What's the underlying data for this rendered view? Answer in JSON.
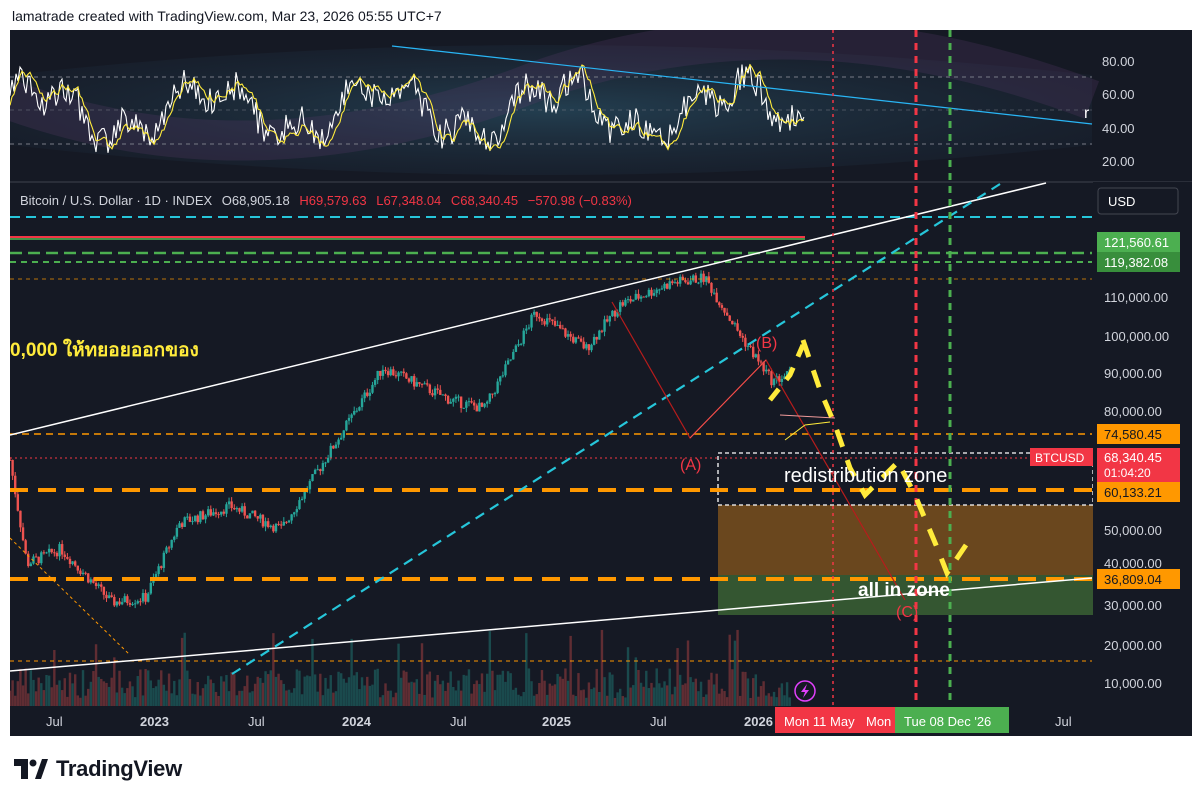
{
  "header": {
    "attribution": "lamatrade created with TradingView.com, Mar 23, 2026 05:55 UTC+7"
  },
  "footer": {
    "brand": "TradingView"
  },
  "symbol_line": {
    "name": "Bitcoin / U.S. Dollar · 1D · INDEX",
    "open": "O68,905.18",
    "high": "H69,579.63",
    "low": "L67,348.04",
    "close": "C68,340.45",
    "change": "−570.98 (−0.83%)"
  },
  "currency_button": "USD",
  "oscillator": {
    "axis_ticks": [
      "80.00",
      "60.00",
      "40.00",
      "20.00"
    ],
    "cut_label": "r"
  },
  "price_axis": {
    "ticks": [
      "110,000.00",
      "100,000.00",
      "90,000.00",
      "80,000.00",
      "50,000.00",
      "40,000.00",
      "30,000.00",
      "20,000.00",
      "10,000.00"
    ]
  },
  "price_badges": {
    "b1": "121,560.61",
    "b2": "119,382.08",
    "b3": "74,580.45",
    "b4_symbol": "BTCUSD",
    "b4_price": "68,340.45",
    "b4_timer": "01:04:20",
    "b5": "60,133.21",
    "b6": "36,809.04"
  },
  "time_axis": {
    "ticks": [
      "Jul",
      "2023",
      "Jul",
      "2024",
      "Jul",
      "2025",
      "Jul",
      "2026",
      "Jul"
    ],
    "badge_red": "Mon 11 May",
    "badge_red2": "Mon",
    "badge_green": "Tue 08 Dec '26"
  },
  "annotations": {
    "thai_text": "0,000 ให้ทยอยออกของ",
    "wave_a": "(A)",
    "wave_b": "(B)",
    "wave_c": "(C)",
    "redistribution": "redistribution zone",
    "all_in": "all in zone"
  },
  "colors": {
    "background": "#151924",
    "orange": "#ff9800",
    "green": "#4caf50",
    "red": "#f23645",
    "cyan": "#26c6da",
    "yellow": "#ffeb3b",
    "candle_up": "#26a69a",
    "candle_down": "#ef5350"
  },
  "chart_data": {
    "type": "candlestick",
    "symbol": "BTCUSD",
    "x_range": [
      "2022-05",
      "2026-12"
    ],
    "y_range": [
      0,
      130000
    ],
    "key_levels": [
      121560.61,
      119382.08,
      74580.45,
      68340.45,
      60133.21,
      36809.04
    ],
    "price_path": [
      [
        "2022-05",
        40000
      ],
      [
        "2022-06",
        21000
      ],
      [
        "2022-08",
        23000
      ],
      [
        "2022-11",
        16500
      ],
      [
        "2023-01",
        17000
      ],
      [
        "2023-03",
        27000
      ],
      [
        "2023-06",
        30000
      ],
      [
        "2023-09",
        26000
      ],
      [
        "2023-12",
        43000
      ],
      [
        "2024-03",
        71000
      ],
      [
        "2024-07",
        58000
      ],
      [
        "2024-09",
        55000
      ],
      [
        "2024-12",
        100000
      ],
      [
        "2025-03",
        80000
      ],
      [
        "2025-05",
        105000
      ],
      [
        "2025-08",
        120000
      ],
      [
        "2025-10",
        124000
      ],
      [
        "2025-12",
        88000
      ],
      [
        "2026-02",
        65000
      ],
      [
        "2026-03",
        68340
      ]
    ],
    "zones": [
      {
        "name": "redistribution zone",
        "from": 56000,
        "to": 70000
      },
      {
        "name": "orange zone",
        "from": 38000,
        "to": 56000
      },
      {
        "name": "all in zone",
        "from": 28000,
        "to": 38000
      }
    ]
  }
}
